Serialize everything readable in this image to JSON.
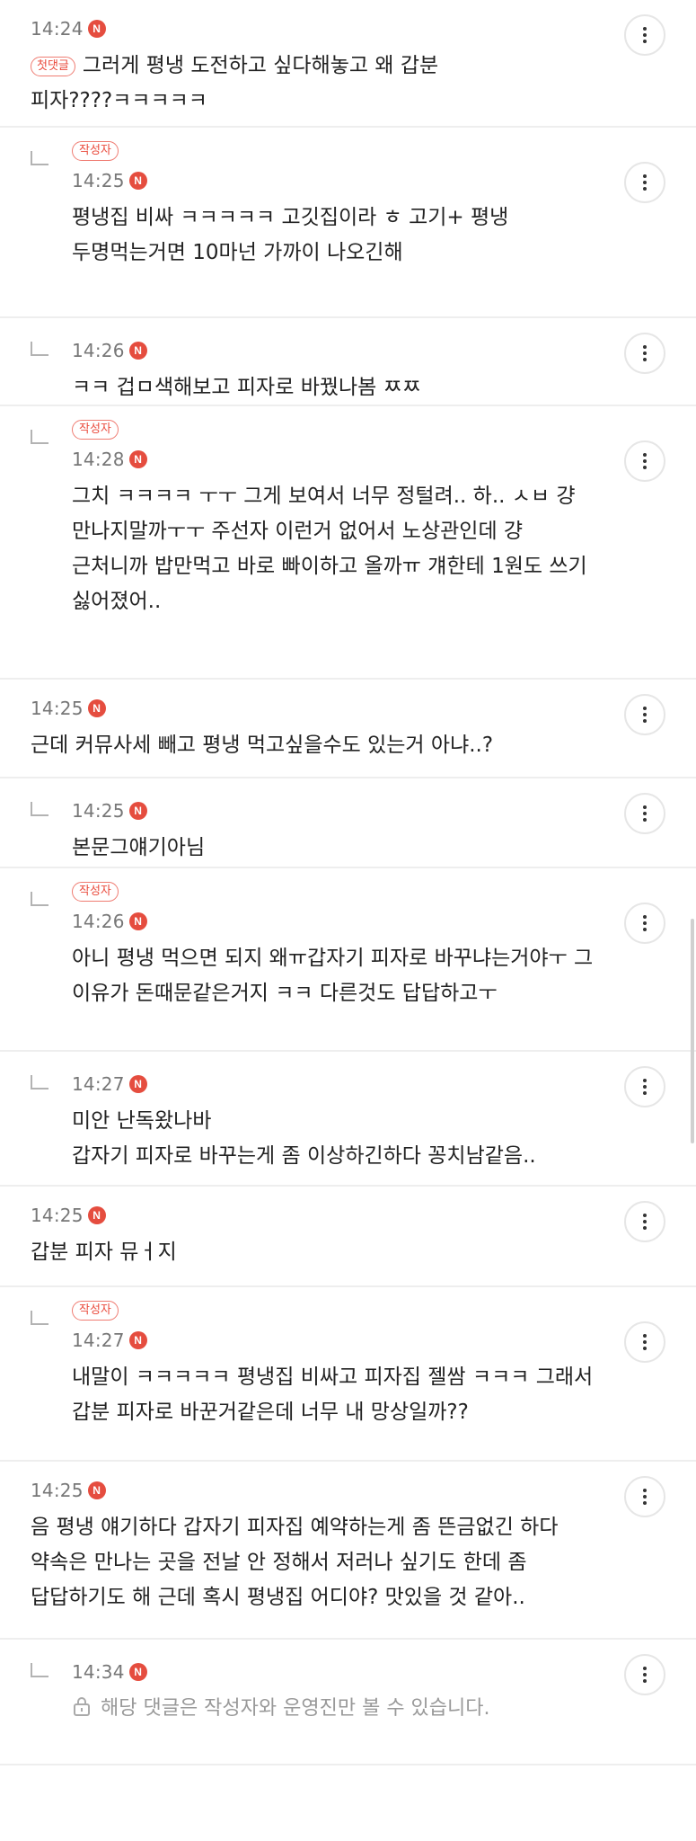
{
  "labels": {
    "first_comment": "첫댓글",
    "author": "작성자",
    "new": "N"
  },
  "comments": [
    {
      "time": "14:24",
      "reply": false,
      "author": false,
      "first": true,
      "text": "그러게 평냉 도전하고 싶다해놓고 왜 갑분\n피자????ㅋㅋㅋㅋㅋ"
    },
    {
      "time": "14:25",
      "reply": true,
      "author": true,
      "text": "평냉집 비싸 ㅋㅋㅋㅋㅋ 고깃집이라 ㅎ 고기+ 평냉\n두명먹는거면 10마넌 가까이 나오긴해"
    },
    {
      "time": "14:26",
      "reply": true,
      "author": false,
      "text": "ㅋㅋ 겁ㅁ색해보고 피자로 바꿨나봄 ㅉㅉ"
    },
    {
      "time": "14:28",
      "reply": true,
      "author": true,
      "text": "그치 ㅋㅋㅋㅋ ㅜㅜ 그게 보여서 너무 정털려.. 하.. ㅅㅂ 걍\n만나지말까ㅜㅜ 주선자 이런거 없어서 노상관인데 걍\n근처니까 밥만먹고 바로 빠이하고 올까ㅠ 걔한테 1원도 쓰기\n싫어졌어.."
    },
    {
      "time": "14:25",
      "reply": false,
      "author": false,
      "text": "근데 커뮤사세 빼고 평냉 먹고싶을수도 있는거 아냐..?"
    },
    {
      "time": "14:25",
      "reply": true,
      "author": false,
      "text": "본문그얘기아님"
    },
    {
      "time": "14:26",
      "reply": true,
      "author": true,
      "text": "아니 평냉 먹으면 되지 왜ㅠ갑자기 피자로 바꾸냐는거야ㅜ 그\n이유가 돈때문같은거지 ㅋㅋ 다른것도 답답하고ㅜ"
    },
    {
      "time": "14:27",
      "reply": true,
      "author": false,
      "text": "미안 난독왔나바\n갑자기 피자로 바꾸는게 좀 이상하긴하다 꽁치남같음.."
    },
    {
      "time": "14:25",
      "reply": false,
      "author": false,
      "text": "갑분 피자 뮤ㅓ지"
    },
    {
      "time": "14:27",
      "reply": true,
      "author": true,
      "text": "내말이 ㅋㅋㅋㅋㅋ 평냉집 비싸고 피자집 젤쌈 ㅋㅋㅋ 그래서\n갑분 피자로 바꾼거같은데 너무 내 망상일까??"
    },
    {
      "time": "14:25",
      "reply": false,
      "author": false,
      "text": "음 평냉 얘기하다 갑자기 피자집 예약하는게 좀 뜬금없긴 하다\n약속은 만나는 곳을 전날 안 정해서 저러나 싶기도 한데 좀\n답답하기도 해 근데 혹시 평냉집 어디야? 맛있을 것 같아.."
    },
    {
      "time": "14:34",
      "reply": true,
      "author": false,
      "locked": true,
      "text": "해당 댓글은 작성자와 운영진만 볼 수 있습니다."
    }
  ]
}
